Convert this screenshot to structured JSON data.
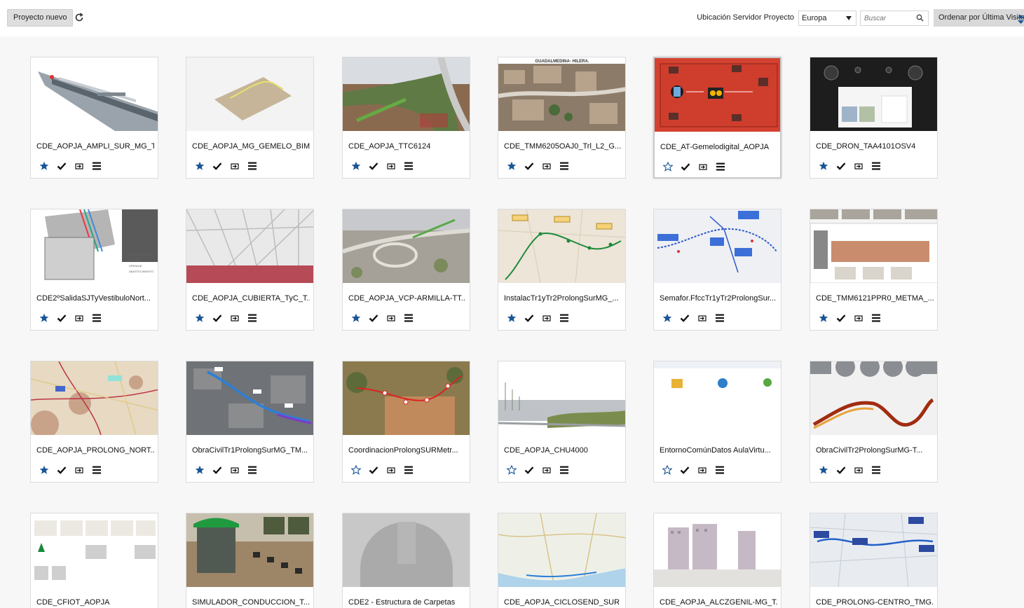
{
  "toolbar": {
    "new_project_label": "Proyecto nuevo",
    "server_label": "Ubicación Servidor Proyecto",
    "server_value": "Europa",
    "search_placeholder": "Buscar",
    "order_label": "Ordenar por Última Visita"
  },
  "colors": {
    "star": "#1a5596",
    "card_border": "#dcdcdc"
  },
  "projects": [
    {
      "title": "CDE_AOPJA_AMPLI_SUR_MG_T...",
      "favorite": true,
      "thumb": "model"
    },
    {
      "title": "CDE_AOPJA_MG_GEMELO_BIM...",
      "favorite": true,
      "thumb": "terrain"
    },
    {
      "title": "CDE_AOPJA_TTC6124",
      "favorite": true,
      "thumb": "road"
    },
    {
      "title": "CDE_TMM6205OAJ0_Trl_L2_G...",
      "favorite": true,
      "thumb": "aerial",
      "thumb_text": "GUADALMEDINA- HILERA."
    },
    {
      "title": "CDE_AT-Gemelodigital_AOPJA",
      "favorite": false,
      "thumb": "redinfo",
      "selected": true
    },
    {
      "title": "CDE_DRON_TAA4101OSV4",
      "favorite": true,
      "thumb": "dron"
    },
    {
      "title": "CDE2ºSalidaSJTyVestibuloNort...",
      "favorite": true,
      "thumb": "section"
    },
    {
      "title": "CDE_AOPJA_CUBIERTA_TyC_T...",
      "favorite": true,
      "thumb": "roof"
    },
    {
      "title": "CDE_AOPJA_VCP-ARMILLA-TT...",
      "favorite": true,
      "thumb": "interchange"
    },
    {
      "title": "InstalacTr1yTr2ProlongSurMG_...",
      "favorite": true,
      "thumb": "mapgreen"
    },
    {
      "title": "Semafor.FfccTr1yTr2ProlongSur...",
      "favorite": true,
      "thumb": "mapblue"
    },
    {
      "title": "CDE_TMM6121PPR0_METMA_...",
      "favorite": true,
      "thumb": "gallery"
    },
    {
      "title": "CDE_AOPJA_PROLONG_NORT...",
      "favorite": true,
      "thumb": "mapred"
    },
    {
      "title": "ObraCivilTr1ProlongSurMG_TM...",
      "favorite": true,
      "thumb": "satblue"
    },
    {
      "title": "CoordinacionProlongSURMetr...",
      "favorite": false,
      "thumb": "satred"
    },
    {
      "title": "CDE_AOPJA_CHU4000",
      "favorite": false,
      "thumb": "pointcloud"
    },
    {
      "title": "EntornoComúnDatos AulaVirtu...",
      "favorite": false,
      "thumb": "folders"
    },
    {
      "title": "ObraCivilTr2ProlongSurMG-T...",
      "favorite": true,
      "thumb": "curve"
    },
    {
      "title": "CDE_CFIOT_AOPJA",
      "favorite": true,
      "thumb": "dashboard"
    },
    {
      "title": "SIMULADOR_CONDUCCION_T...",
      "favorite": true,
      "thumb": "simulator"
    },
    {
      "title": "CDE2 - Estructura de Carpetas",
      "favorite": false,
      "thumb": "helmet"
    },
    {
      "title": "CDE_AOPJA_CICLOSEND_SUR",
      "favorite": false,
      "thumb": "mapcoast"
    },
    {
      "title": "CDE_AOPJA_ALCZGENIL-MG_T...",
      "favorite": false,
      "thumb": "buildings"
    },
    {
      "title": "CDE_PROLONG-CENTRO_TMG...",
      "favorite": false,
      "thumb": "mapcity"
    }
  ]
}
